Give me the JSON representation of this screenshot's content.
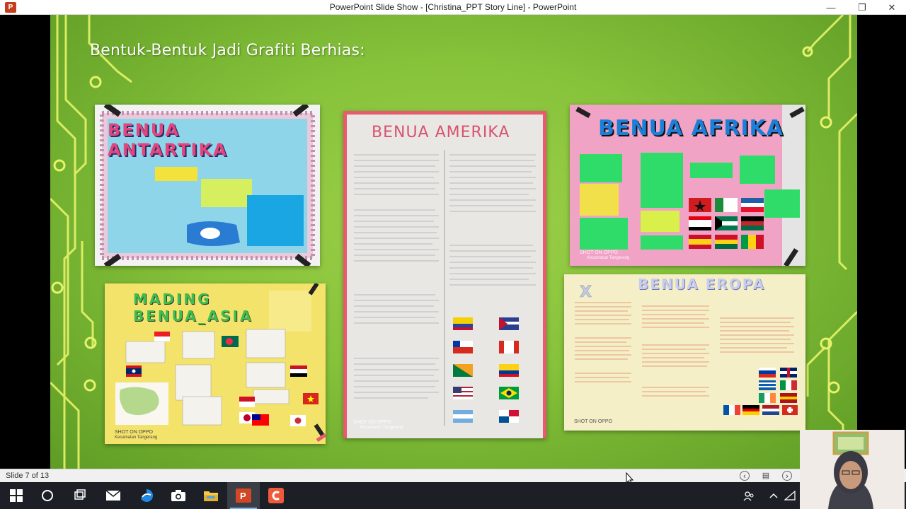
{
  "window": {
    "title": "PowerPoint Slide Show - [Christina_PPT Story Line] - PowerPoint",
    "app_icon": "P",
    "controls": {
      "minimize": "—",
      "restore": "❐",
      "close": "✕"
    }
  },
  "slide": {
    "title": "Bentuk-Bentuk Jadi Grafiti Berhias:",
    "photos": [
      {
        "name": "Antartika board",
        "heading": "BENUA ANTARTIKA"
      },
      {
        "name": "Amerika board",
        "heading": "BENUA AMERIKA",
        "watermark": "SHOT ON OPPO",
        "watermark2": "Kecamatan Tangerang"
      },
      {
        "name": "Afrika board",
        "heading": "BENUA AFRIKA",
        "watermark": "SHOT ON OPPO",
        "watermark2": "Kecamatan Tangerang"
      },
      {
        "name": "Asia board",
        "heading": "MADING BENUA_ASIA",
        "watermark": "SHOT ON OPPO",
        "watermark2": "Kecamatan Tangerang"
      },
      {
        "name": "Eropa board",
        "heading": "BENUA EROPA",
        "watermark": "SHOT ON OPPO"
      }
    ]
  },
  "statusbar": {
    "slide_counter": "Slide 7 of 13",
    "prev_icon": "‹",
    "menu_icon": "▤",
    "next_icon": "›"
  },
  "taskbar": {
    "items": [
      "start-icon",
      "search-icon",
      "task-view-icon",
      "mail-icon",
      "edge-icon",
      "camera-icon",
      "file-explorer-icon",
      "powerpoint-icon",
      "screen-recorder-icon"
    ],
    "tray": [
      "people-icon",
      "chevron-up-icon",
      "network-icon"
    ]
  },
  "colors": {
    "slide_green": "#86c23a",
    "circuit": "#e7f36a",
    "taskbar": "#1c1f26",
    "powerpoint_brand": "#c43e1c"
  }
}
